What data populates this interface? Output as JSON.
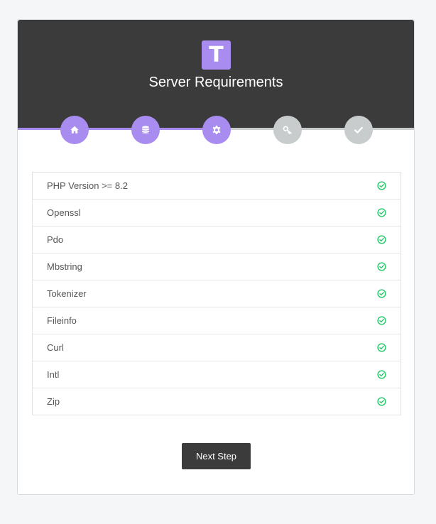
{
  "header": {
    "logo_letter": "T",
    "title": "Server Requirements"
  },
  "colors": {
    "accent": "#a98cf0",
    "dark": "#3b3b3b",
    "inactive": "#c9cccd",
    "success": "#2ecc71"
  },
  "steps": [
    {
      "icon": "home-icon",
      "status": "done"
    },
    {
      "icon": "database-icon",
      "status": "done"
    },
    {
      "icon": "gear-icon",
      "status": "done"
    },
    {
      "icon": "key-icon",
      "status": "pending"
    },
    {
      "icon": "check-icon",
      "status": "pending"
    }
  ],
  "requirements": [
    {
      "name": "PHP Version >= 8.2",
      "status": "ok"
    },
    {
      "name": "Openssl",
      "status": "ok"
    },
    {
      "name": "Pdo",
      "status": "ok"
    },
    {
      "name": "Mbstring",
      "status": "ok"
    },
    {
      "name": "Tokenizer",
      "status": "ok"
    },
    {
      "name": "Fileinfo",
      "status": "ok"
    },
    {
      "name": "Curl",
      "status": "ok"
    },
    {
      "name": "Intl",
      "status": "ok"
    },
    {
      "name": "Zip",
      "status": "ok"
    }
  ],
  "actions": {
    "next_label": "Next Step"
  }
}
